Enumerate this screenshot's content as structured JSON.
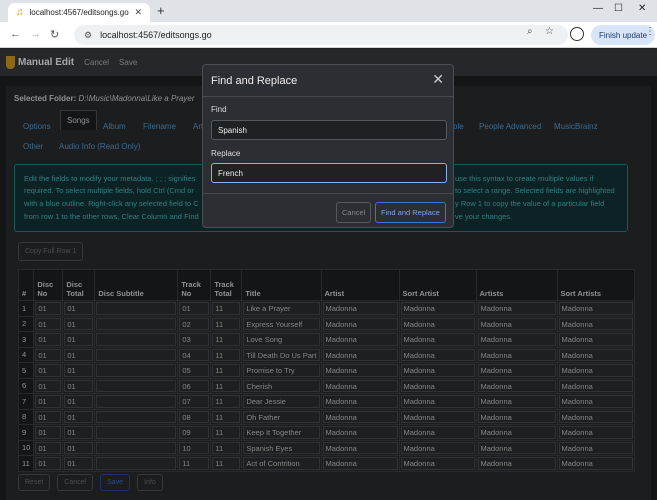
{
  "browser": {
    "tab_title": "localhost:4567/editsongs.go",
    "url": "localhost:4567/editsongs.go",
    "finish_update_label": "Finish update"
  },
  "app": {
    "brand": "Manual Edit",
    "header_links": [
      "Cancel",
      "Save"
    ]
  },
  "page": {
    "selected_folder_label": "Selected Folder:",
    "selected_folder_path": "D:\\Music\\Madonna\\Like a Prayer",
    "tabs": [
      "Options",
      "Songs",
      "Album",
      "Filename",
      "Art",
      "ple",
      "People Advanced",
      "MusicBrainz",
      "Other",
      "Audio Info (Read Only)"
    ],
    "info_lines": [
      "Edit the fields to modify your metadata. ; ; ; signifies",
      "use this syntax to create multiple values if",
      "required. To select multiple fields, hold Ctrl (Cmd or",
      "to select a range. Selected fields are highlighted",
      "with a blue outline. Right-click any selected field to C",
      "y Row 1 to copy the value of a particular field",
      "from row 1 to the other rows, Clear Column and Find",
      "ve your changes."
    ],
    "copy_row_button": "Copy Full Row 1",
    "columns": [
      "#",
      "Disc No",
      "Disc Total",
      "Disc Subtitle",
      "Track No",
      "Track Total",
      "Title",
      "Artist",
      "Sort Artist",
      "Artists",
      "Sort Artists"
    ],
    "rows": [
      [
        "1",
        "01",
        "01",
        "",
        "01",
        "11",
        "Like a Prayer",
        "Madonna",
        "Madonna",
        "Madonna",
        "Madonna"
      ],
      [
        "2",
        "01",
        "01",
        "",
        "02",
        "11",
        "Express Yourself",
        "Madonna",
        "Madonna",
        "Madonna",
        "Madonna"
      ],
      [
        "3",
        "01",
        "01",
        "",
        "03",
        "11",
        "Love Song",
        "Madonna",
        "Madonna",
        "Madonna",
        "Madonna"
      ],
      [
        "4",
        "01",
        "01",
        "",
        "04",
        "11",
        "Till Death Do Us Part",
        "Madonna",
        "Madonna",
        "Madonna",
        "Madonna"
      ],
      [
        "5",
        "01",
        "01",
        "",
        "05",
        "11",
        "Promise to Try",
        "Madonna",
        "Madonna",
        "Madonna",
        "Madonna"
      ],
      [
        "6",
        "01",
        "01",
        "",
        "06",
        "11",
        "Cherish",
        "Madonna",
        "Madonna",
        "Madonna",
        "Madonna"
      ],
      [
        "7",
        "01",
        "01",
        "",
        "07",
        "11",
        "Dear Jessie",
        "Madonna",
        "Madonna",
        "Madonna",
        "Madonna"
      ],
      [
        "8",
        "01",
        "01",
        "",
        "08",
        "11",
        "Oh Father",
        "Madonna",
        "Madonna",
        "Madonna",
        "Madonna"
      ],
      [
        "9",
        "01",
        "01",
        "",
        "09",
        "11",
        "Keep It Together",
        "Madonna",
        "Madonna",
        "Madonna",
        "Madonna"
      ],
      [
        "10",
        "01",
        "01",
        "",
        "10",
        "11",
        "Spanish Eyes",
        "Madonna",
        "Madonna",
        "Madonna",
        "Madonna"
      ],
      [
        "11",
        "01",
        "01",
        "",
        "11",
        "11",
        "Act of Contrition",
        "Madonna",
        "Madonna",
        "Madonna",
        "Madonna"
      ]
    ],
    "action_buttons": [
      "Reset",
      "Cancel",
      "Save",
      "Info"
    ]
  },
  "modal": {
    "title": "Find and Replace",
    "find_label": "Find",
    "find_value": "Spanish",
    "replace_label": "Replace",
    "replace_value": "French",
    "cancel_label": "Cancel",
    "submit_label": "Find and Replace"
  }
}
